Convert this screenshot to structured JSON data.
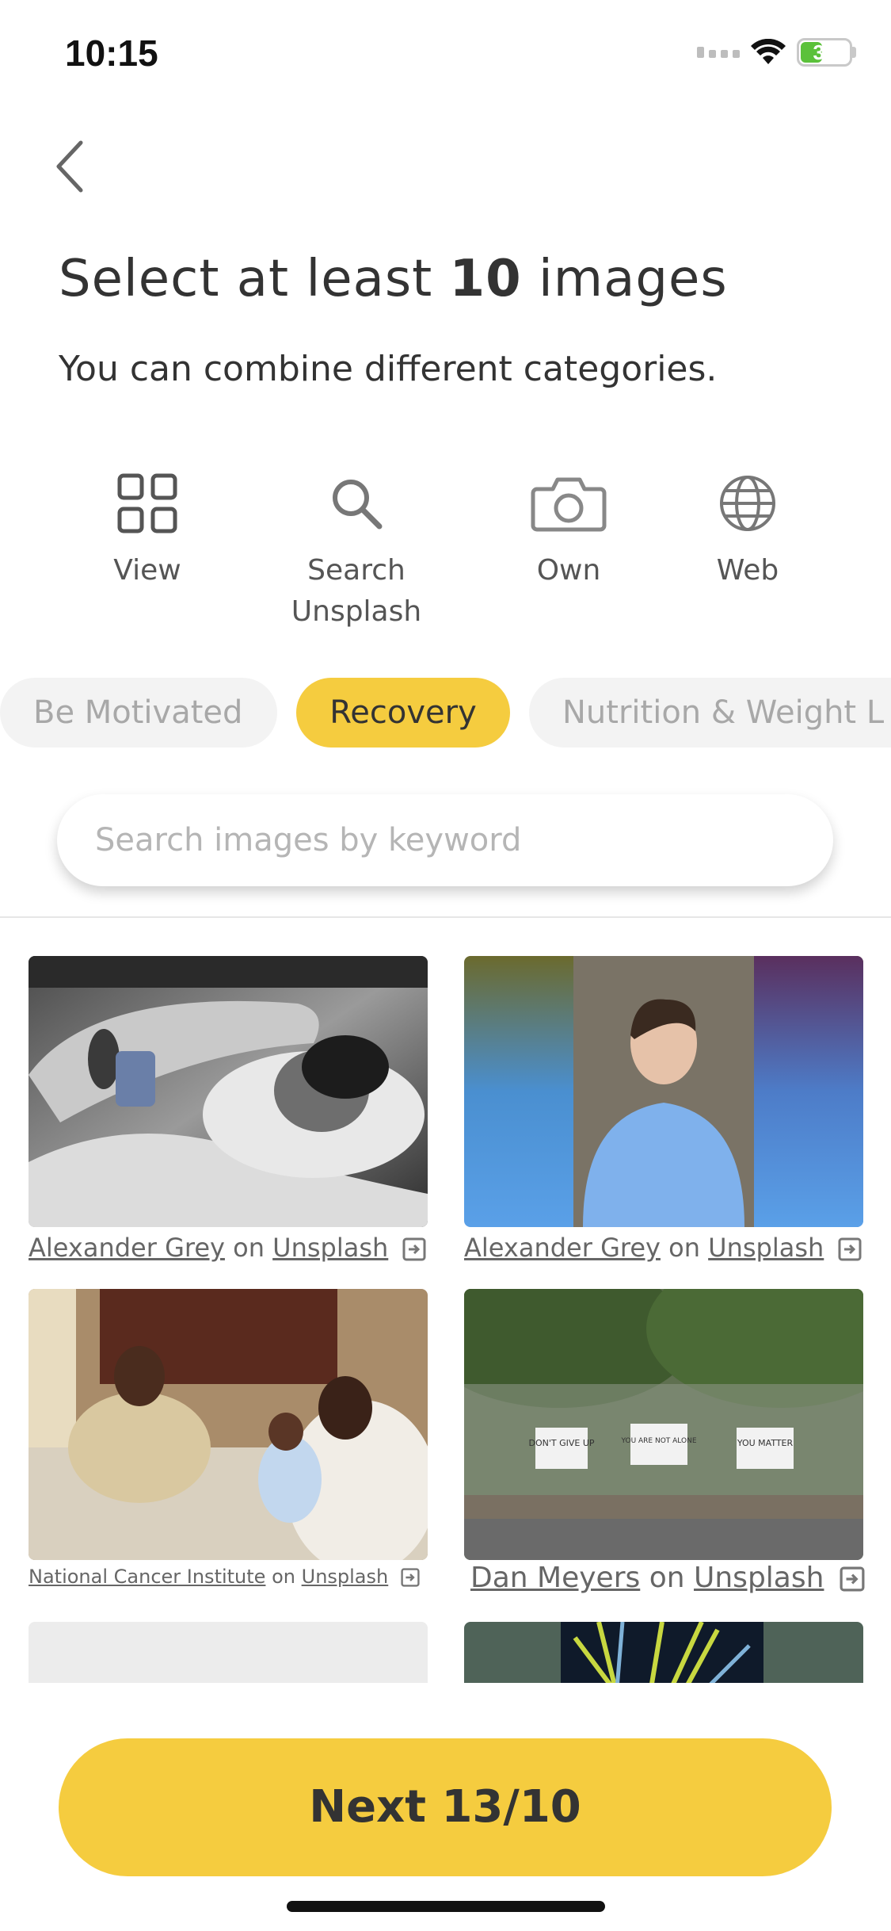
{
  "status_bar": {
    "time": "10:15",
    "battery": "34"
  },
  "header": {
    "title_prefix": "Select at least ",
    "title_number": "10",
    "title_suffix": " images",
    "subtitle": "You can combine different categories."
  },
  "sources": [
    {
      "label": "View",
      "icon": "grid-icon"
    },
    {
      "label": "Search\nUnsplash",
      "icon": "search-icon"
    },
    {
      "label": "Own",
      "icon": "camera-icon"
    },
    {
      "label": "Web",
      "icon": "globe-icon"
    }
  ],
  "categories": [
    {
      "label": "Be Motivated",
      "active": false
    },
    {
      "label": "Recovery",
      "active": true
    },
    {
      "label": "Nutrition & Weight L",
      "active": false
    }
  ],
  "search": {
    "placeholder": "Search images by keyword"
  },
  "images": [
    {
      "author": "Alexander Grey",
      "on": "on",
      "source": "Unsplash"
    },
    {
      "author": "Alexander Grey",
      "on": "on",
      "source": "Unsplash"
    },
    {
      "author": "National Cancer Institute",
      "on": "on",
      "source": "Unsplash"
    },
    {
      "author": "Dan Meyers",
      "on": "on",
      "source": "Unsplash"
    }
  ],
  "sign_texts": [
    "DON'T GIVE UP",
    "YOU ARE NOT ALONE",
    "YOU MATTER"
  ],
  "next_button": {
    "label": "Next 13/10"
  },
  "colors": {
    "accent": "#f5cc3f",
    "chip_inactive_bg": "#f3f3f3",
    "battery": "#5bc13a"
  }
}
